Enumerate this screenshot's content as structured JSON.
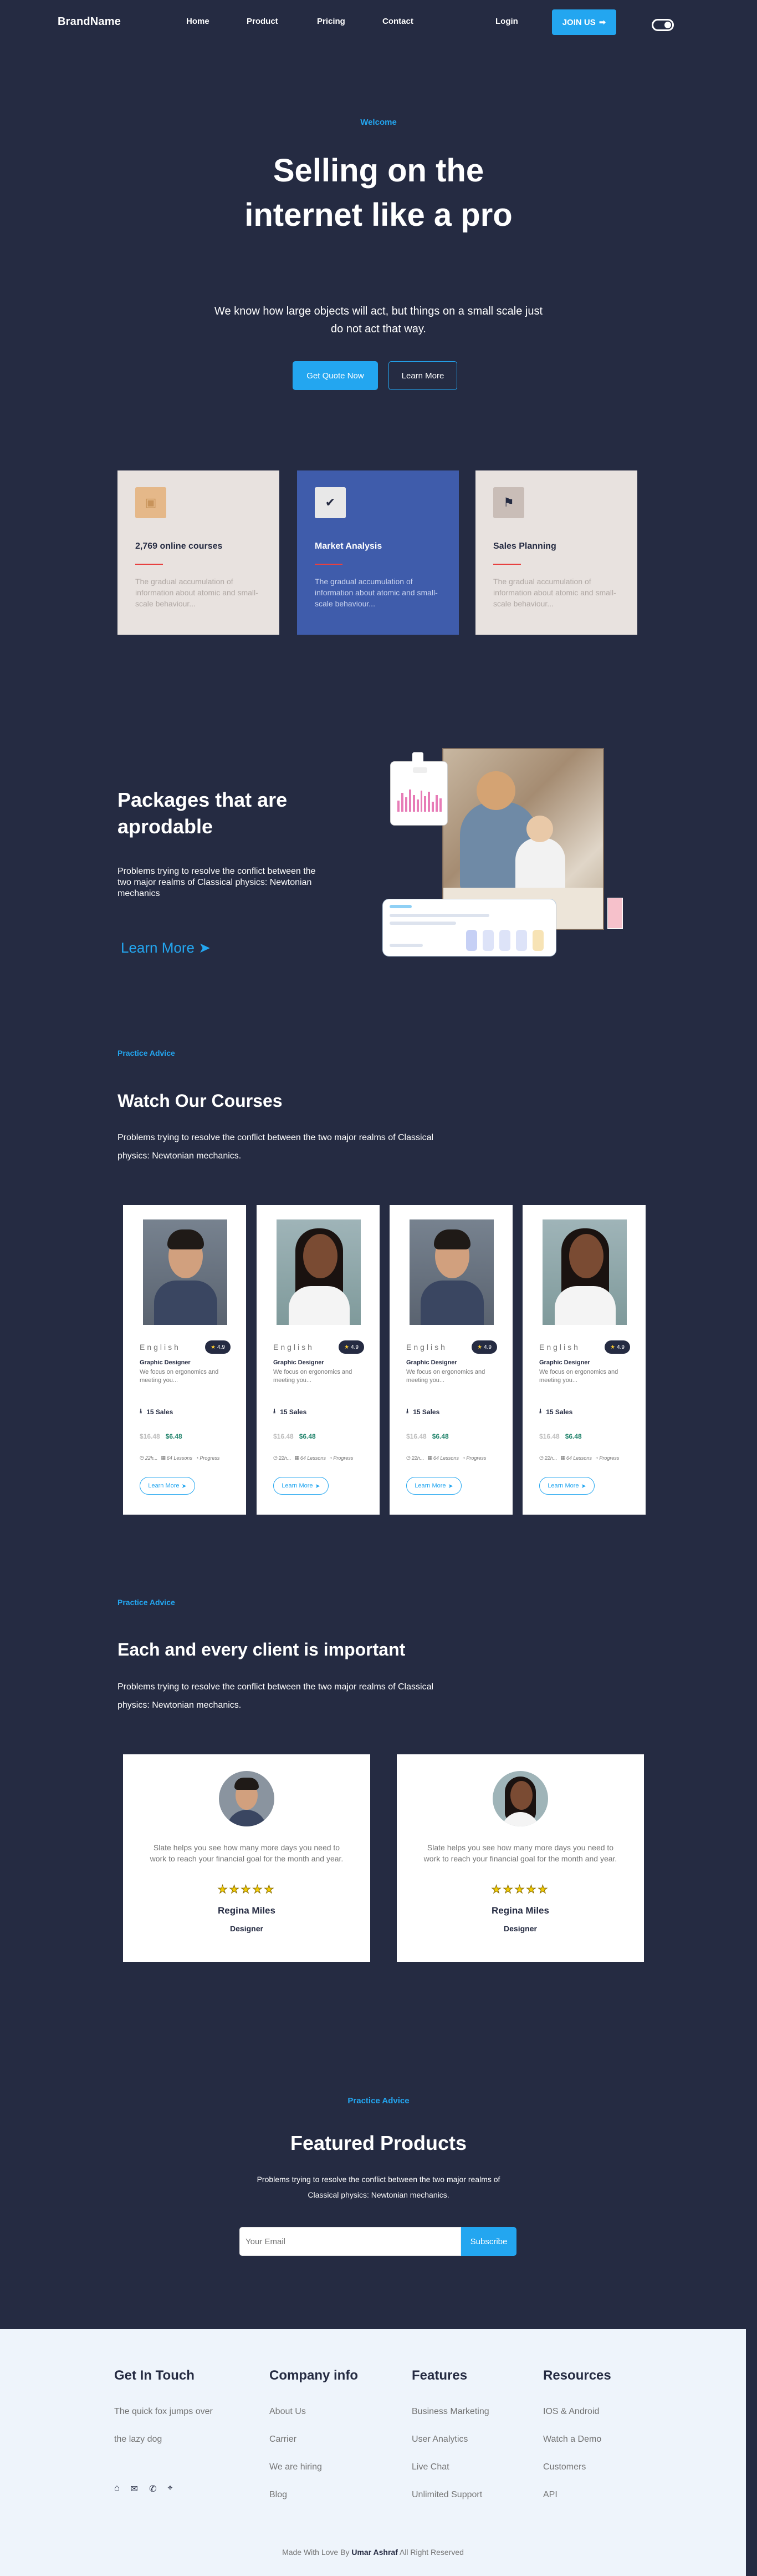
{
  "nav": {
    "brand": "BrandName",
    "links": [
      "Home",
      "Product",
      "Pricing",
      "Contact"
    ],
    "login": "Login",
    "join": "JOIN US",
    "join_icon": "arrow-right-icon",
    "toggle_icon": "toggle-icon"
  },
  "hero": {
    "tag": "Welcome",
    "title": "Selling on the internet like a pro",
    "subtitle": "We know how large objects will act, but things on a small scale just do not act that way.",
    "primary_button": "Get Quote Now",
    "secondary_button": "Learn More"
  },
  "features": [
    {
      "title": "2,769 online courses",
      "desc": "The gradual accumulation of information about atomic and small-scale behaviour...",
      "icon": "book-icon"
    },
    {
      "title": "Market Analysis",
      "desc": "The gradual accumulation of information about atomic and small-scale behaviour...",
      "icon": "check-icon"
    },
    {
      "title": "Sales Planning",
      "desc": "The gradual accumulation of information about atomic and small-scale behaviour...",
      "icon": "flag-icon"
    }
  ],
  "packages": {
    "title": "Packages that are aprodable",
    "desc": "Problems trying to resolve the conflict between the two major realms of Classical physics: Newtonian mechanics",
    "link": "Learn More"
  },
  "courses_section": {
    "tag": "Practice Advice",
    "title": "Watch Our Courses",
    "desc": "Problems trying to resolve the conflict between the two major realms of Classical physics: Newtonian mechanics."
  },
  "courses": [
    {
      "lang": "English",
      "rating": "4.9",
      "role": "Graphic Designer",
      "desc": "We focus on ergonomics and meeting you...",
      "sales": "15 Sales",
      "old_price": "$16.48",
      "new_price": "$6.48",
      "meta": [
        "22h...",
        "64 Lessons",
        "Progress"
      ],
      "button": "Learn More"
    },
    {
      "lang": "English",
      "rating": "4.9",
      "role": "Graphic Designer",
      "desc": "We focus on ergonomics and meeting you...",
      "sales": "15 Sales",
      "old_price": "$16.48",
      "new_price": "$6.48",
      "meta": [
        "22h...",
        "64 Lessons",
        "Progress"
      ],
      "button": "Learn More"
    },
    {
      "lang": "English",
      "rating": "4.9",
      "role": "Graphic Designer",
      "desc": "We focus on ergonomics and meeting you...",
      "sales": "15 Sales",
      "old_price": "$16.48",
      "new_price": "$6.48",
      "meta": [
        "22h...",
        "64 Lessons",
        "Progress"
      ],
      "button": "Learn More"
    },
    {
      "lang": "English",
      "rating": "4.9",
      "role": "Graphic Designer",
      "desc": "We focus on ergonomics and meeting you...",
      "sales": "15 Sales",
      "old_price": "$16.48",
      "new_price": "$6.48",
      "meta": [
        "22h...",
        "64 Lessons",
        "Progress"
      ],
      "button": "Learn More"
    }
  ],
  "clients_section": {
    "tag": "Practice Advice",
    "title": "Each and every client is important",
    "desc": "Problems trying to resolve the conflict between the two major realms of Classical physics: Newtonian mechanics."
  },
  "testimonials": [
    {
      "quote": "Slate helps you see how many more days you need to work to reach your financial goal for the month and year.",
      "stars": "★★★★★",
      "name": "Regina Miles",
      "role": "Designer"
    },
    {
      "quote": "Slate helps you see how many more days you need to work to reach your financial goal for the month and year.",
      "stars": "★★★★★",
      "name": "Regina Miles",
      "role": "Designer"
    }
  ],
  "featured": {
    "tag": "Practice Advice",
    "title": "Featured Products",
    "desc": "Problems trying to resolve the conflict between the two major realms of Classical physics: Newtonian mechanics.",
    "email_placeholder": "Your Email",
    "subscribe": "Subscribe"
  },
  "footer": {
    "touch": {
      "title": "Get In Touch",
      "line1": "The quick fox jumps over",
      "line2": "the lazy dog"
    },
    "company": {
      "title": "Company info",
      "items": [
        "About Us",
        "Carrier",
        "We are hiring",
        "Blog"
      ]
    },
    "features": {
      "title": "Features",
      "items": [
        "Business Marketing",
        "User Analytics",
        "Live Chat",
        "Unlimited Support"
      ]
    },
    "resources": {
      "title": "Resources",
      "items": [
        "IOS & Android",
        "Watch a Demo",
        "Customers",
        "API"
      ]
    },
    "social_icons": [
      "home-icon",
      "mail-icon",
      "phone-icon",
      "location-icon"
    ],
    "copyright_prefix": "Made With Love By",
    "copyright_name": "Umar Ashraf",
    "copyright_suffix": "All Right Reserved"
  },
  "colors": {
    "bg": "#252B42",
    "accent": "#23A6F0",
    "red": "#E74040",
    "green": "#23856D",
    "footer_bg": "#EEF4FB"
  }
}
